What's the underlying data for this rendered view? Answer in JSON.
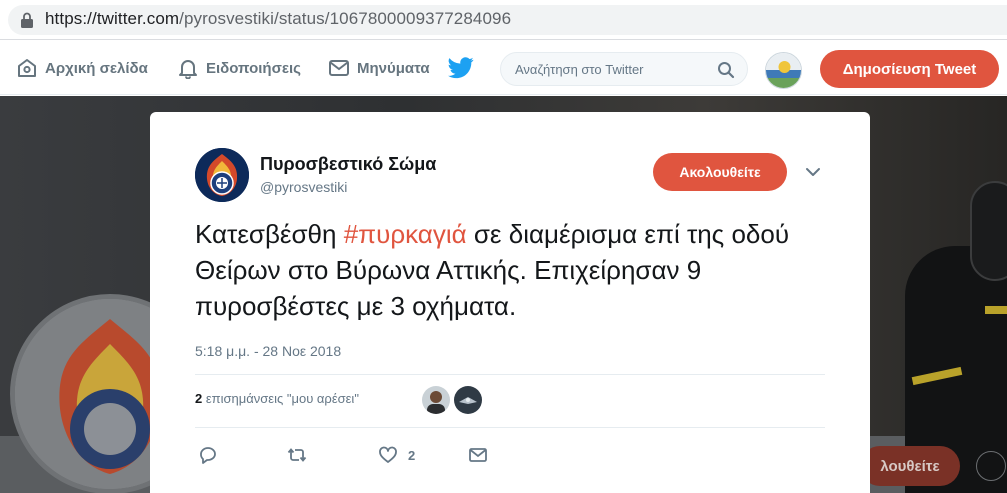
{
  "browser": {
    "url_host": "https://twitter.com",
    "url_path": "/pyrosvestiki/status/1067800009377284096"
  },
  "nav": {
    "home": "Αρχική σελίδα",
    "notifications": "Ειδοποιήσεις",
    "messages": "Μηνύματα",
    "search_placeholder": "Αναζήτηση στο Twitter",
    "tweet_button": "Δημοσίευση Tweet"
  },
  "background": {
    "follow_button": "λουθείτε"
  },
  "tweet": {
    "author_name": "Πυροσβεστικό Σώμα",
    "author_handle": "@pyrosvestiki",
    "follow_button": "Ακολουθείτε",
    "text_before": "Κατεσβέσθη ",
    "hashtag": "#πυρκαγιά",
    "text_after": " σε διαμέρισμα επί της οδού Θείρων στο Βύρωνα Αττικής. Επιχείρησαν 9 πυροσβέστες με 3 οχήματα.",
    "timestamp": "5:18 μ.μ. - 28 Νοε 2018",
    "likes_count": "2",
    "likes_label": "επισημάνσεις \"μου αρέσει\"",
    "action_like_count": "2"
  },
  "colors": {
    "accent": "#e0553f",
    "text_primary": "#14171a",
    "text_secondary": "#657786"
  },
  "icons": [
    "lock-icon",
    "home-icon",
    "bell-icon",
    "envelope-icon",
    "twitter-bird-icon",
    "search-icon",
    "chevron-down-icon",
    "reply-icon",
    "retweet-icon",
    "heart-icon",
    "direct-message-icon"
  ]
}
